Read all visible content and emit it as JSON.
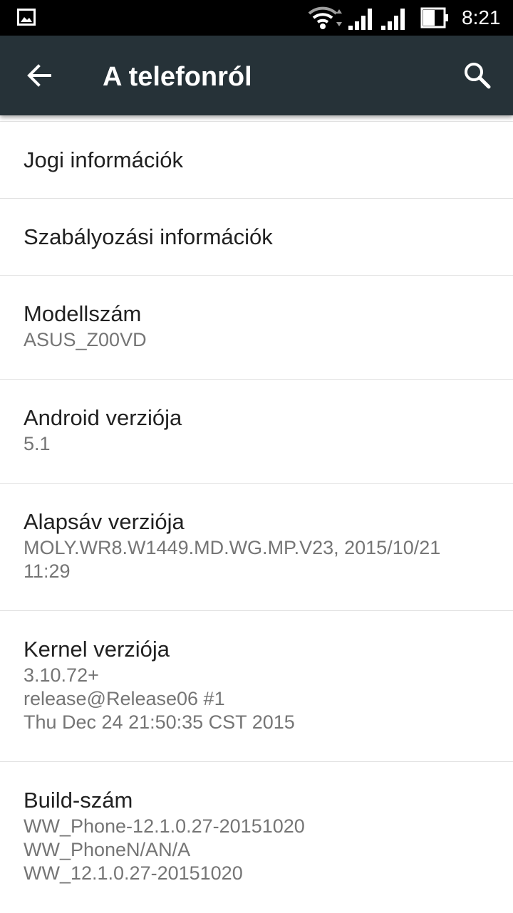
{
  "status_bar": {
    "time": "8:21",
    "icons": [
      "gallery-icon",
      "wifi-icon",
      "signal-icon",
      "signal-icon",
      "battery-icon"
    ]
  },
  "app_bar": {
    "title": "A telefonról",
    "icons": [
      "back-arrow-icon",
      "search-icon"
    ],
    "background": "#263238"
  },
  "items": [
    {
      "title": "Jogi információk"
    },
    {
      "title": "Szabályozási információk"
    },
    {
      "title": "Modellszám",
      "summary": "ASUS_Z00VD"
    },
    {
      "title": "Android verziója",
      "summary": "5.1"
    },
    {
      "title": "Alapsáv verziója",
      "summary": "MOLY.WR8.W1449.MD.WG.MP.V23, 2015/10/21\n11:29"
    },
    {
      "title": "Kernel verziója",
      "summary": "3.10.72+\nrelease@Release06 #1\nThu Dec 24 21:50:35 CST 2015"
    },
    {
      "title": "Build-szám",
      "summary": "WW_Phone-12.1.0.27-20151020\nWW_PhoneN/AN/A\nWW_12.1.0.27-20151020"
    }
  ]
}
